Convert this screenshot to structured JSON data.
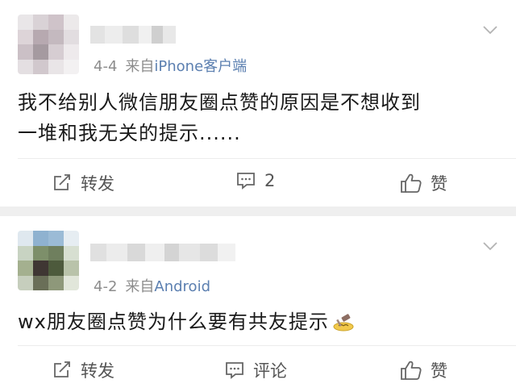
{
  "posts": [
    {
      "date": "4-4",
      "source_prefix": "来自",
      "source": "iPhone客户端",
      "text_line1": "我不给别人微信朋友圈点赞的原因是不想收到",
      "text_line2": "一堆和我无关的提示......",
      "actions": {
        "repost": "转发",
        "comment": "2",
        "like": "赞"
      }
    },
    {
      "date": "4-2",
      "source_prefix": "来自",
      "source": "Android",
      "text": "wx朋友圈点赞为什么要有共友提示",
      "actions": {
        "repost": "转发",
        "comment": "评论",
        "like": "赞"
      }
    }
  ],
  "colors": {
    "link": "#5b7fb0",
    "meta": "#8c8c8c",
    "separator": "#efefef"
  },
  "icons": [
    "chevron-down-icon",
    "repost-icon",
    "comment-icon",
    "like-icon",
    "gavel-emoji-icon"
  ]
}
